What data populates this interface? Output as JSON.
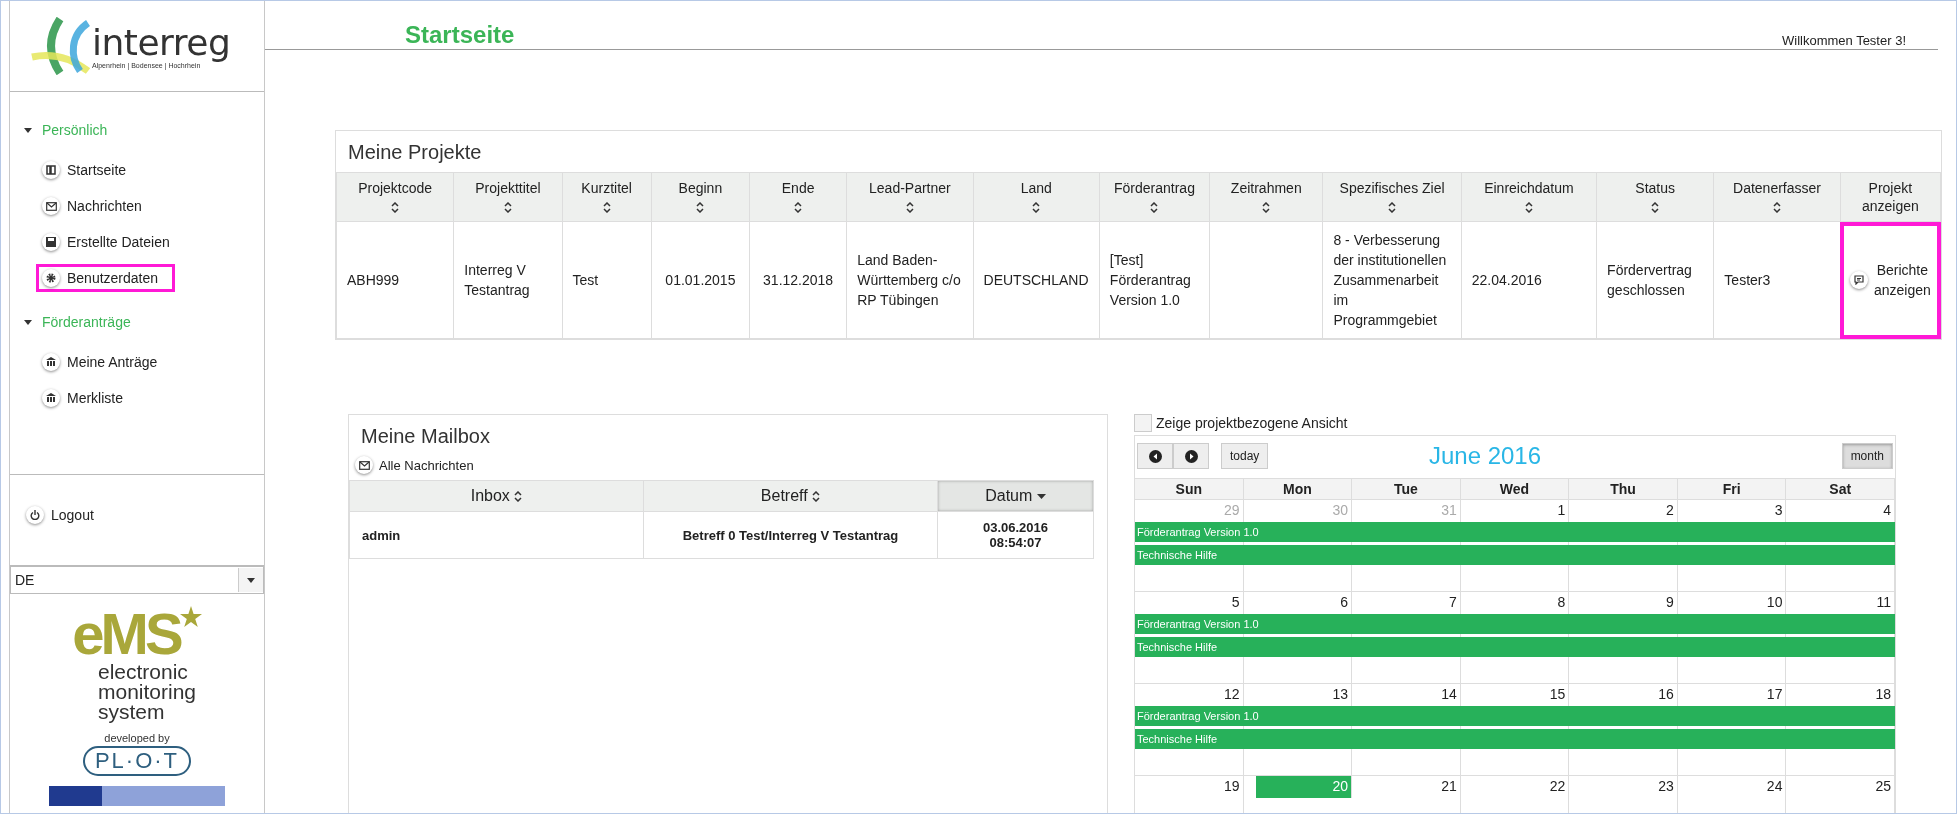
{
  "sidebar": {
    "logo": {
      "name": "interreg",
      "tagline": "Alpenrhein | Bodensee | Hochrhein"
    },
    "sections": [
      {
        "title": "Persönlich",
        "expanded": true,
        "items": [
          {
            "label": "Startseite",
            "kind": "book",
            "highlighted": false
          },
          {
            "label": "Nachrichten",
            "kind": "mail",
            "highlighted": false
          },
          {
            "label": "Erstellte Dateien",
            "kind": "save",
            "highlighted": false
          },
          {
            "label": "Benutzerdaten",
            "kind": "gear",
            "highlighted": true
          }
        ]
      },
      {
        "title": "Förderanträge",
        "expanded": true,
        "items": [
          {
            "label": "Meine Anträge",
            "kind": "bank",
            "highlighted": false
          },
          {
            "label": "Merkliste",
            "kind": "bank",
            "highlighted": false
          }
        ]
      }
    ],
    "logout": "Logout",
    "language": "DE",
    "ems_logo": {
      "mark": "eMS",
      "words": [
        "electronic",
        "monitoring",
        "system"
      ],
      "developed_by": "developed by",
      "developer": "PL·O·T"
    }
  },
  "header": {
    "title": "Startseite",
    "welcome": "Willkommen Tester 3!"
  },
  "projects": {
    "title": "Meine Projekte",
    "columns": [
      {
        "label": "Projektcode",
        "kind": "sortable"
      },
      {
        "label": "Projekttitel",
        "kind": "sortable"
      },
      {
        "label": "Kurztitel",
        "kind": "sortable"
      },
      {
        "label": "Beginn",
        "kind": "sortable"
      },
      {
        "label": "Ende",
        "kind": "sortable"
      },
      {
        "label": "Lead-Partner",
        "kind": "sortable"
      },
      {
        "label": "Land",
        "kind": "sortable"
      },
      {
        "label": "Förderantrag",
        "kind": "sortable"
      },
      {
        "label": "Zeitrahmen",
        "kind": "sortable"
      },
      {
        "label": "Spezifisches Ziel",
        "kind": "sortable"
      },
      {
        "label": "Einreichdatum",
        "kind": "sortable"
      },
      {
        "label": "Status",
        "kind": "sortable"
      },
      {
        "label": "Datenerfasser",
        "kind": "sortable"
      },
      {
        "label": "Projekt anzeigen",
        "kind": "plain"
      }
    ],
    "rows": [
      {
        "cells": [
          "ABH999",
          "Interreg V Testantrag",
          "Test",
          "01.01.2015",
          "31.12.2018",
          "Land Baden-Württemberg c/o RP Tübingen",
          "DEUTSCHLAND",
          "[Test] Förderantrag Version 1.0",
          "",
          "8 - Verbesserung der institutionellen Zusammenarbeit im Programmgebiet",
          "22.04.2016",
          "Fördervertrag geschlossen",
          "Tester3"
        ],
        "action": {
          "label": "Berichte anzeigen",
          "highlighted": true
        }
      }
    ]
  },
  "mailbox": {
    "title": "Meine Mailbox",
    "all_link": "Alle Nachrichten",
    "columns": [
      {
        "label": "Inbox",
        "kind": "sortable"
      },
      {
        "label": "Betreff",
        "kind": "sortable"
      },
      {
        "label": "Datum",
        "kind": "sorted_descending"
      }
    ],
    "rows": [
      {
        "cells": [
          "admin",
          "Betreff 0 Test/Interreg V Testantrag",
          "03.06.2016\n08:54:07"
        ]
      }
    ]
  },
  "calendar": {
    "checkbox": {
      "label": "Zeige projektbezogene Ansicht",
      "checked": false
    },
    "title": "June 2016",
    "today_button": "today",
    "view_button": {
      "label": "month",
      "selected": true
    },
    "weekdays": [
      "Sun",
      "Mon",
      "Tue",
      "Wed",
      "Thu",
      "Fri",
      "Sat"
    ],
    "weeks": [
      {
        "days": [
          {
            "label": "29",
            "other_month": true,
            "today": false
          },
          {
            "label": "30",
            "other_month": true,
            "today": false
          },
          {
            "label": "31",
            "other_month": true,
            "today": false
          },
          {
            "label": "1",
            "other_month": false,
            "today": false
          },
          {
            "label": "2",
            "other_month": false,
            "today": false
          },
          {
            "label": "3",
            "other_month": false,
            "today": false
          },
          {
            "label": "4",
            "other_month": false,
            "today": false
          }
        ],
        "events": [
          "Förderantrag Version 1.0",
          "Technische Hilfe"
        ]
      },
      {
        "days": [
          {
            "label": "5",
            "other_month": false,
            "today": false
          },
          {
            "label": "6",
            "other_month": false,
            "today": false
          },
          {
            "label": "7",
            "other_month": false,
            "today": false
          },
          {
            "label": "8",
            "other_month": false,
            "today": false
          },
          {
            "label": "9",
            "other_month": false,
            "today": false
          },
          {
            "label": "10",
            "other_month": false,
            "today": false
          },
          {
            "label": "11",
            "other_month": false,
            "today": false
          }
        ],
        "events": [
          "Förderantrag Version 1.0",
          "Technische Hilfe"
        ]
      },
      {
        "days": [
          {
            "label": "12",
            "other_month": false,
            "today": false
          },
          {
            "label": "13",
            "other_month": false,
            "today": false
          },
          {
            "label": "14",
            "other_month": false,
            "today": false
          },
          {
            "label": "15",
            "other_month": false,
            "today": false
          },
          {
            "label": "16",
            "other_month": false,
            "today": false
          },
          {
            "label": "17",
            "other_month": false,
            "today": false
          },
          {
            "label": "18",
            "other_month": false,
            "today": false
          }
        ],
        "events": [
          "Förderantrag Version 1.0",
          "Technische Hilfe"
        ]
      },
      {
        "days": [
          {
            "label": "19",
            "other_month": false,
            "today": false
          },
          {
            "label": "20",
            "other_month": false,
            "today": true
          },
          {
            "label": "21",
            "other_month": false,
            "today": false
          },
          {
            "label": "22",
            "other_month": false,
            "today": false
          },
          {
            "label": "23",
            "other_month": false,
            "today": false
          },
          {
            "label": "24",
            "other_month": false,
            "today": false
          },
          {
            "label": "25",
            "other_month": false,
            "today": false
          }
        ]
      }
    ]
  }
}
